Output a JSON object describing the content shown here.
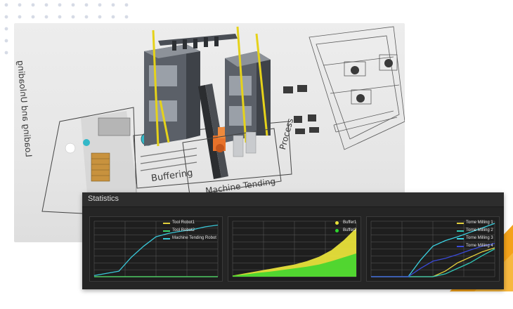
{
  "scene": {
    "labels": {
      "loading": "Loading and Unloading",
      "buffering": "Buffering",
      "machine_tending": "Machine Tending",
      "process": "Process"
    }
  },
  "statistics": {
    "title": "Statistics",
    "charts": [
      {
        "legend": [
          "Tool Robot1",
          "Tool Robot2",
          "Machine Tending Robot"
        ],
        "colors": [
          "#e3d03c",
          "#3bd46e",
          "#39c7d8"
        ]
      },
      {
        "legend": [
          "Buffer1",
          "Buffer2"
        ],
        "colors": [
          "#e8e23a",
          "#2ed62e"
        ]
      },
      {
        "legend": [
          "Torne Milling 1",
          "Torne Milling 2",
          "Torne Milling 3",
          "Torne Milling 4"
        ],
        "colors": [
          "#e3d03c",
          "#30c8b8",
          "#3ad0e0",
          "#3a4ad8"
        ]
      }
    ]
  },
  "chart_data": [
    {
      "type": "line",
      "x": [
        0,
        1,
        2,
        3,
        4,
        5,
        6,
        7,
        8,
        9,
        10
      ],
      "series": [
        {
          "name": "Tool Robot1",
          "values": [
            0,
            0,
            0,
            0,
            0,
            0,
            0,
            0,
            0,
            0,
            0
          ]
        },
        {
          "name": "Tool Robot2",
          "values": [
            0,
            0,
            0,
            0,
            0,
            0,
            0,
            0,
            0,
            0,
            0
          ]
        },
        {
          "name": "Machine Tending Robot",
          "values": [
            2,
            6,
            10,
            35,
            55,
            72,
            78,
            82,
            85,
            90,
            93
          ]
        }
      ],
      "ylim": [
        0,
        100
      ],
      "grid": true,
      "legend_position": "top-right"
    },
    {
      "type": "area",
      "x": [
        0,
        1,
        2,
        3,
        4,
        5,
        6,
        7,
        8,
        9,
        10
      ],
      "series": [
        {
          "name": "Buffer1",
          "values": [
            2,
            6,
            10,
            14,
            18,
            22,
            28,
            36,
            48,
            66,
            88
          ]
        },
        {
          "name": "Buffer2",
          "values": [
            2,
            4,
            7,
            9,
            12,
            15,
            18,
            22,
            28,
            35,
            42
          ]
        }
      ],
      "ylim": [
        0,
        100
      ],
      "grid": true,
      "legend_position": "top-right"
    },
    {
      "type": "line",
      "x": [
        0,
        1,
        2,
        3,
        4,
        5,
        6,
        7,
        8,
        9,
        10
      ],
      "series": [
        {
          "name": "Torne Milling 1",
          "values": [
            0,
            0,
            0,
            0,
            0,
            0,
            10,
            25,
            35,
            45,
            52
          ]
        },
        {
          "name": "Torne Milling 2",
          "values": [
            0,
            0,
            0,
            0,
            0,
            0,
            5,
            15,
            25,
            38,
            50
          ]
        },
        {
          "name": "Torne Milling 3",
          "values": [
            0,
            0,
            0,
            0,
            30,
            55,
            65,
            72,
            80,
            88,
            96
          ]
        },
        {
          "name": "Torne Milling 4",
          "values": [
            0,
            0,
            0,
            0,
            15,
            28,
            33,
            40,
            48,
            55,
            60
          ]
        }
      ],
      "ylim": [
        0,
        100
      ],
      "grid": true,
      "legend_position": "top-right"
    }
  ]
}
